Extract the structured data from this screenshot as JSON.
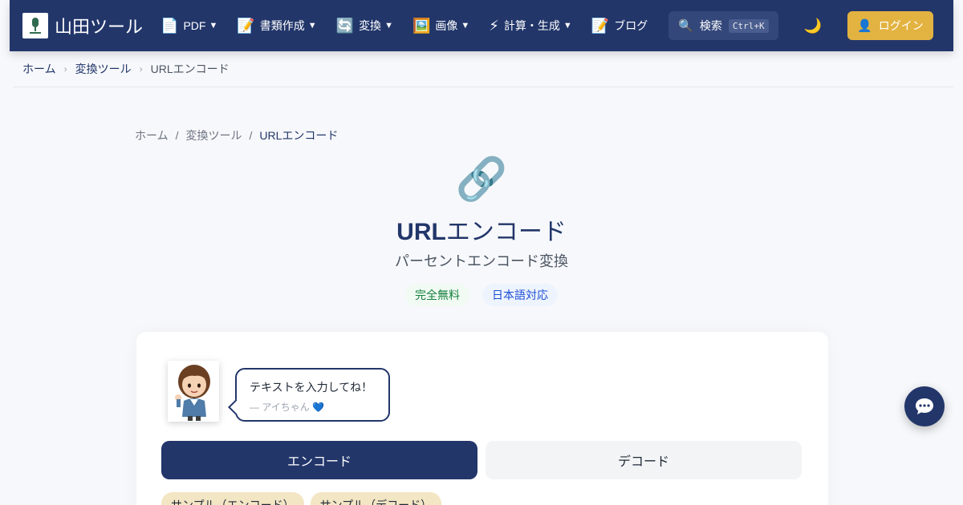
{
  "header": {
    "logo_text": "山田ツール",
    "nav": [
      {
        "icon": "📄",
        "label": "PDF",
        "caret": "▼"
      },
      {
        "icon": "📝",
        "label": "書類作成",
        "caret": "▼"
      },
      {
        "icon": "🔄",
        "label": "変換",
        "caret": "▼"
      },
      {
        "icon": "🖼️",
        "label": "画像",
        "caret": "▼"
      },
      {
        "icon": "⚡",
        "label": "計算・生成",
        "caret": "▼"
      },
      {
        "icon": "📝",
        "label": "ブログ",
        "caret": ""
      }
    ],
    "search_icon": "🔍",
    "search_label": "検索",
    "search_shortcut": "Ctrl+K",
    "theme_icon": "🌙",
    "login_icon": "👤",
    "login_label": "ログイン"
  },
  "breadcrumb_top": {
    "items": [
      "ホーム",
      "変換ツール",
      "URLエンコード"
    ],
    "separator": "›"
  },
  "breadcrumb_inner": {
    "items": [
      "ホーム",
      "変換ツール",
      "URLエンコード"
    ],
    "separator": "/"
  },
  "hero": {
    "icon": "🔗",
    "title_bold": "URL",
    "title_rest": "エンコード",
    "subtitle": "パーセントエンコード変換",
    "badges": [
      "完全無料",
      "日本語対応"
    ]
  },
  "assistant": {
    "message": "テキストを入力してね！",
    "signature": "— アイちゃん 💙"
  },
  "tabs": {
    "encode": "エンコード",
    "decode": "デコード"
  },
  "samples": [
    "サンプル（エンコード）",
    "サンプル（デコード）"
  ],
  "colors": {
    "primary": "#22366a",
    "accent": "#e3b341",
    "sample_bg": "#f3e6c4"
  }
}
